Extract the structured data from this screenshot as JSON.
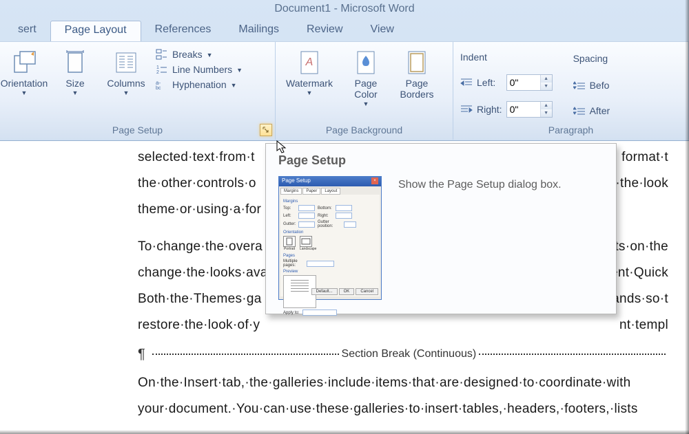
{
  "title": "Document1  -  Microsoft Word",
  "tabs": [
    "sert",
    "Page Layout",
    "References",
    "Mailings",
    "Review",
    "View"
  ],
  "active_tab": 1,
  "groups": {
    "page_setup": {
      "label": "Page Setup",
      "orientation": "Orientation",
      "size": "Size",
      "columns": "Columns",
      "breaks": "Breaks",
      "line_numbers": "Line Numbers",
      "hyphenation": "Hyphenation"
    },
    "page_background": {
      "label": "Page Background",
      "watermark": "Watermark",
      "page_color": "Page Color",
      "page_borders": "Page Borders"
    },
    "paragraph": {
      "label": "Paragraph",
      "indent": "Indent",
      "left": "Left:",
      "right": "Right:",
      "left_val": "0\"",
      "right_val": "0\"",
      "spacing": "Spacing",
      "before": "Befo",
      "after": "After"
    }
  },
  "tooltip": {
    "title": "Page Setup",
    "desc": "Show the Page Setup dialog box.",
    "dlg_title": "Page Setup"
  },
  "doc": {
    "l1": "selected·text·from·t",
    "l1b": "format·t",
    "l2": "the·other·controls·o",
    "l2b": "·the·look",
    "l3": "theme·or·using·a·for",
    "l4": "To·change·the·overa",
    "l4b": "ts·on·the",
    "l5": "change·the·looks·ava",
    "l5b": "ent·Quick",
    "l6": "Both·the·Themes·ga",
    "l6b": "ands·so·t",
    "l7": "restore·the·look·of·y",
    "l7b": "nt·templ",
    "sb": "Section Break (Continuous)",
    "l8": "On·the·Insert·tab,·the·galleries·include·items·that·are·designed·to·coordinate·with",
    "l9": "your·document.·You·can·use·these·galleries·to·insert·tables,·headers,·footers,·lists"
  }
}
